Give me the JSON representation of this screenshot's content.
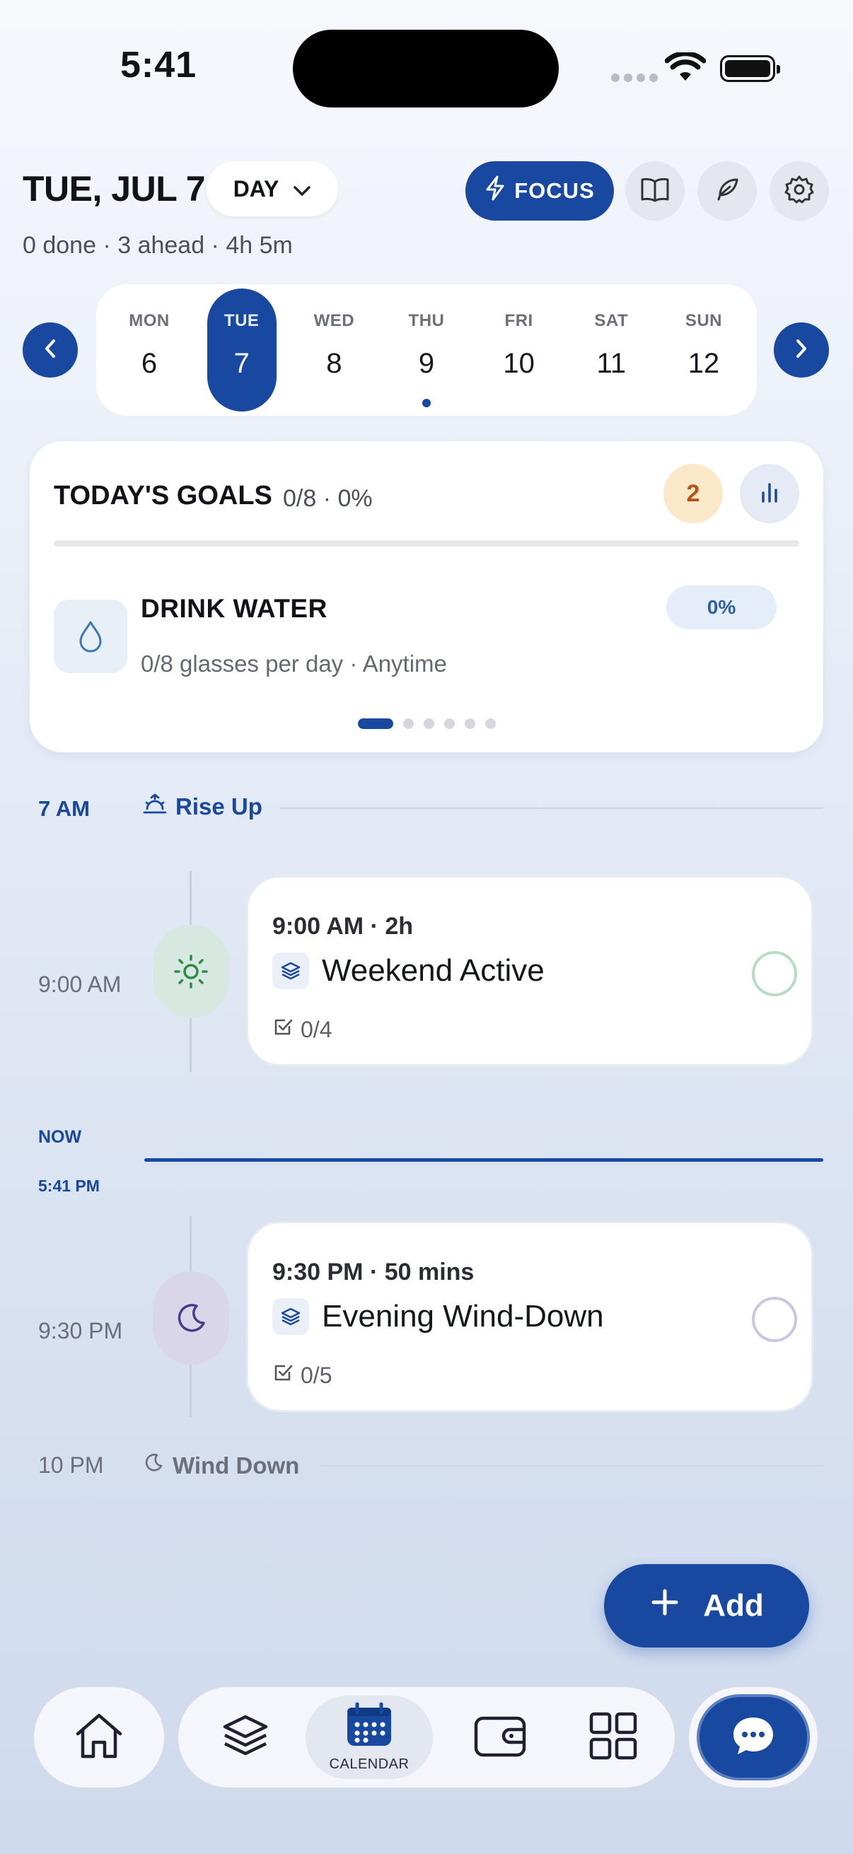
{
  "status": {
    "time": "5:41"
  },
  "header": {
    "date": "TUE, JUL 7",
    "view": "DAY",
    "focus_label": "FOCUS",
    "summary": "0 done · 3 ahead · 4h 5m"
  },
  "week": {
    "days": [
      {
        "name": "MON",
        "num": "6"
      },
      {
        "name": "TUE",
        "num": "7"
      },
      {
        "name": "WED",
        "num": "8"
      },
      {
        "name": "THU",
        "num": "9"
      },
      {
        "name": "FRI",
        "num": "10"
      },
      {
        "name": "SAT",
        "num": "11"
      },
      {
        "name": "SUN",
        "num": "12"
      }
    ],
    "selected_index": 1,
    "dot_index": 3
  },
  "goals": {
    "title": "TODAY'S GOALS",
    "progress": "0/8 · 0%",
    "progress_fraction": 0,
    "streak": "2",
    "goal": {
      "name": "DRINK WATER",
      "desc": "0/8 glasses per day · Anytime",
      "pct": "0%"
    },
    "pager_count": 6,
    "pager_active": 0
  },
  "timeline": {
    "rise_time": "7 AM",
    "rise_label": "Rise Up",
    "events": [
      {
        "time": "9:00 AM",
        "head": "9:00 AM · 2h",
        "title": "Weekend Active",
        "checklist": "0/4"
      },
      {
        "time": "9:30 PM",
        "head": "9:30 PM · 50 mins",
        "title": "Evening Wind-Down",
        "checklist": "0/5"
      }
    ],
    "now_label": "NOW",
    "now_time": "5:41 PM",
    "wind_time": "10 PM",
    "wind_label": "Wind Down"
  },
  "add_label": "Add",
  "nav": {
    "calendar_label": "CALENDAR"
  },
  "colors": {
    "accent": "#1848a0",
    "sun_bubble": "#d7e8e0",
    "moon_bubble": "#d9d6ea"
  }
}
